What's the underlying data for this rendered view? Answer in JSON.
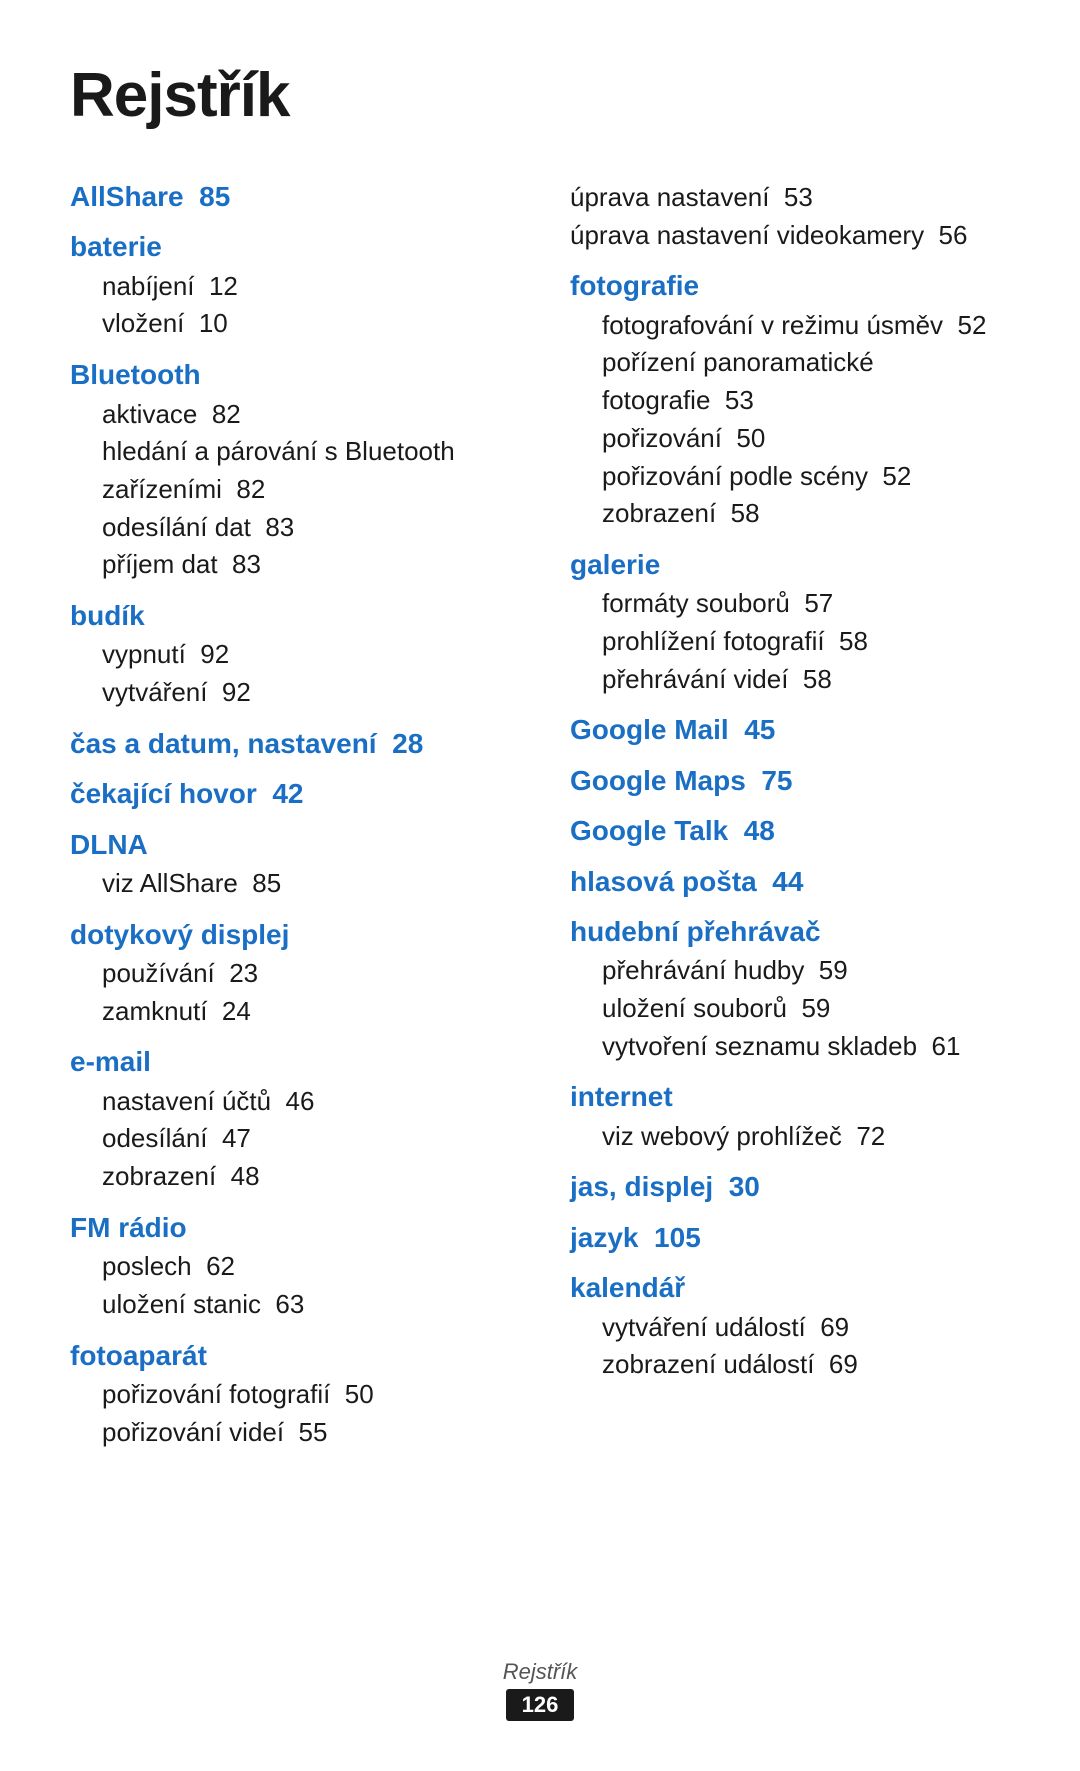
{
  "title": "Rejstřík",
  "left_column": [
    {
      "header": "AllShare",
      "header_page": "85",
      "items": []
    },
    {
      "header": "baterie",
      "header_page": "",
      "items": [
        {
          "text": "nabíjení",
          "page": "12"
        },
        {
          "text": "vložení",
          "page": "10"
        }
      ]
    },
    {
      "header": "Bluetooth",
      "header_page": "",
      "items": [
        {
          "text": "aktivace",
          "page": "82"
        },
        {
          "text": "hledání a párování s Bluetooth zařízeními",
          "page": "82"
        },
        {
          "text": "odesílání dat",
          "page": "83"
        },
        {
          "text": "příjem dat",
          "page": "83"
        }
      ]
    },
    {
      "header": "budík",
      "header_page": "",
      "items": [
        {
          "text": "vypnutí",
          "page": "92"
        },
        {
          "text": "vytváření",
          "page": "92"
        }
      ]
    },
    {
      "header": "čas a datum, nastavení",
      "header_page": "28",
      "items": []
    },
    {
      "header": "čekající hovor",
      "header_page": "42",
      "items": []
    },
    {
      "header": "DLNA",
      "header_page": "",
      "items": [
        {
          "text": "viz AllShare",
          "page": "85"
        }
      ]
    },
    {
      "header": "dotykový displej",
      "header_page": "",
      "items": [
        {
          "text": "používání",
          "page": "23"
        },
        {
          "text": "zamknutí",
          "page": "24"
        }
      ]
    },
    {
      "header": "e-mail",
      "header_page": "",
      "items": [
        {
          "text": "nastavení účtů",
          "page": "46"
        },
        {
          "text": "odesílání",
          "page": "47"
        },
        {
          "text": "zobrazení",
          "page": "48"
        }
      ]
    },
    {
      "header": "FM rádio",
      "header_page": "",
      "items": [
        {
          "text": "poslech",
          "page": "62"
        },
        {
          "text": "uložení stanic",
          "page": "63"
        }
      ]
    },
    {
      "header": "fotoaparát",
      "header_page": "",
      "items": [
        {
          "text": "pořizování fotografií",
          "page": "50"
        },
        {
          "text": "pořizování videí",
          "page": "55"
        }
      ]
    }
  ],
  "right_column": [
    {
      "header": "",
      "header_page": "",
      "items": [
        {
          "text": "úprava nastavení",
          "page": "53"
        },
        {
          "text": "úprava nastavení videokamery",
          "page": "56"
        }
      ]
    },
    {
      "header": "fotografie",
      "header_page": "",
      "items": [
        {
          "text": "fotografování v režimu úsměv",
          "page": "52"
        },
        {
          "text": "pořízení panoramatické fotografie",
          "page": "53"
        },
        {
          "text": "pořizování",
          "page": "50"
        },
        {
          "text": "pořizování podle scény",
          "page": "52"
        },
        {
          "text": "zobrazení",
          "page": "58"
        }
      ]
    },
    {
      "header": "galerie",
      "header_page": "",
      "items": [
        {
          "text": "formáty souborů",
          "page": "57"
        },
        {
          "text": "prohlížení fotografií",
          "page": "58"
        },
        {
          "text": "přehrávání videí",
          "page": "58"
        }
      ]
    },
    {
      "header": "Google Mail",
      "header_page": "45",
      "items": []
    },
    {
      "header": "Google Maps",
      "header_page": "75",
      "items": []
    },
    {
      "header": "Google Talk",
      "header_page": "48",
      "items": []
    },
    {
      "header": "hlasová pošta",
      "header_page": "44",
      "items": []
    },
    {
      "header": "hudební přehrávač",
      "header_page": "",
      "items": [
        {
          "text": "přehrávání hudby",
          "page": "59"
        },
        {
          "text": "uložení souborů",
          "page": "59"
        },
        {
          "text": "vytvoření seznamu skladeb",
          "page": "61"
        }
      ]
    },
    {
      "header": "internet",
      "header_page": "",
      "items": [
        {
          "text": "viz webový prohlížeč",
          "page": "72"
        }
      ]
    },
    {
      "header": "jas, displej",
      "header_page": "30",
      "items": []
    },
    {
      "header": "jazyk",
      "header_page": "105",
      "items": []
    },
    {
      "header": "kalendář",
      "header_page": "",
      "items": [
        {
          "text": "vytváření událostí",
          "page": "69"
        },
        {
          "text": "zobrazení událostí",
          "page": "69"
        }
      ]
    }
  ],
  "footer": {
    "label": "Rejstřík",
    "page": "126"
  }
}
